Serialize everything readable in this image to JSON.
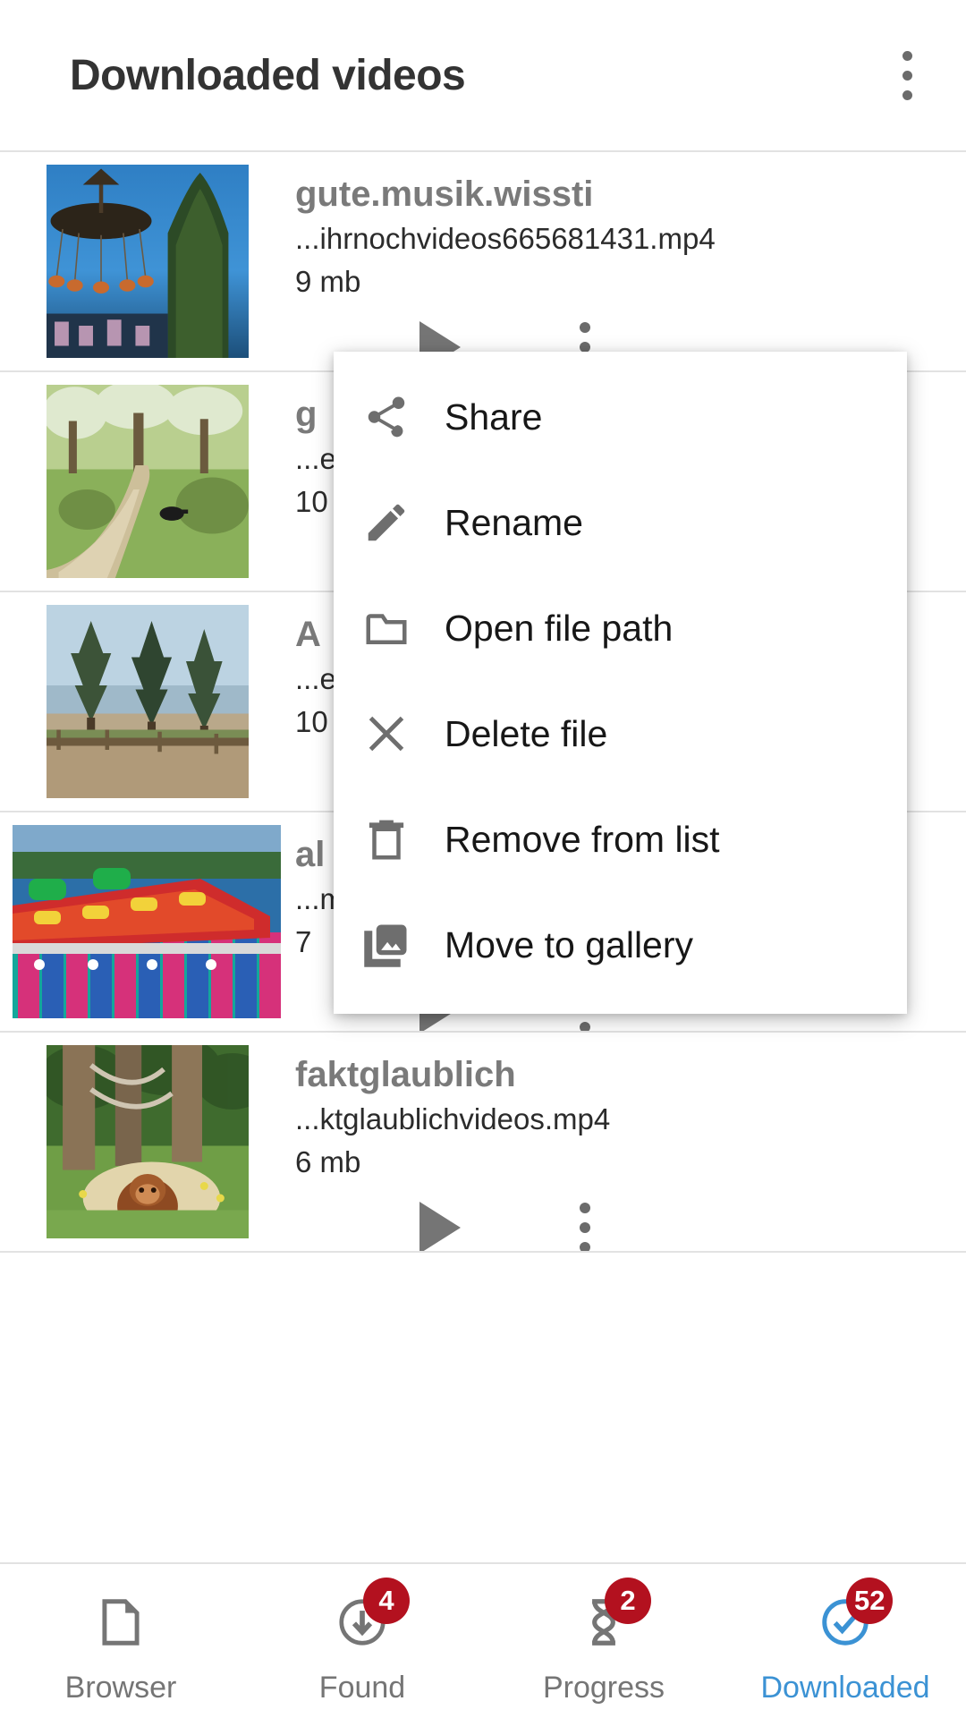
{
  "appbar": {
    "title": "Downloaded videos",
    "overflow_icon": "kebab-menu-icon"
  },
  "videos": [
    {
      "title": "gute.musik.wissti",
      "path": "...ihrnochvideos665681431.mp4",
      "size": "9 mb",
      "thumb": "carousel-ride-night",
      "play_icon": "play-icon",
      "menu_icon": "kebab-menu-icon"
    },
    {
      "title": "g",
      "path": "...e",
      "size": "10",
      "thumb": "forest-path-blossom",
      "play_icon": "play-icon",
      "menu_icon": "kebab-menu-icon"
    },
    {
      "title": "A",
      "path": "...e",
      "size": "10",
      "thumb": "pine-trees-hillside",
      "play_icon": "play-icon",
      "menu_icon": "kebab-menu-icon"
    },
    {
      "title": "al",
      "path": "...m",
      "size": "7",
      "thumb": "fairground-ride-colorful",
      "play_icon": "play-icon",
      "menu_icon": "kebab-menu-icon"
    },
    {
      "title": "faktglaublich",
      "path": "...ktglaublichvideos.mp4",
      "size": "6 mb",
      "thumb": "orangutan-in-grass",
      "play_icon": "play-icon",
      "menu_icon": "kebab-menu-icon"
    }
  ],
  "context_menu": {
    "items": [
      {
        "label": "Share",
        "icon": "share-icon"
      },
      {
        "label": "Rename",
        "icon": "pencil-icon"
      },
      {
        "label": "Open file path",
        "icon": "folder-icon"
      },
      {
        "label": "Delete file",
        "icon": "close-x-icon"
      },
      {
        "label": "Remove from list",
        "icon": "trash-icon"
      },
      {
        "label": "Move to gallery",
        "icon": "photo-library-icon"
      }
    ]
  },
  "bottom_nav": {
    "items": [
      {
        "label": "Browser",
        "icon": "page-icon",
        "badge": "",
        "active": false
      },
      {
        "label": "Found",
        "icon": "download-circle-icon",
        "badge": "4",
        "active": false
      },
      {
        "label": "Progress",
        "icon": "hourglass-icon",
        "badge": "2",
        "active": false
      },
      {
        "label": "Downloaded",
        "icon": "check-circle-icon",
        "badge": "52",
        "active": true
      }
    ]
  },
  "colors": {
    "accent": "#3b92d4",
    "badge": "#b3111f",
    "title_text": "#333333",
    "item_title": "#7a7a7a",
    "icon_gray": "#757575"
  }
}
